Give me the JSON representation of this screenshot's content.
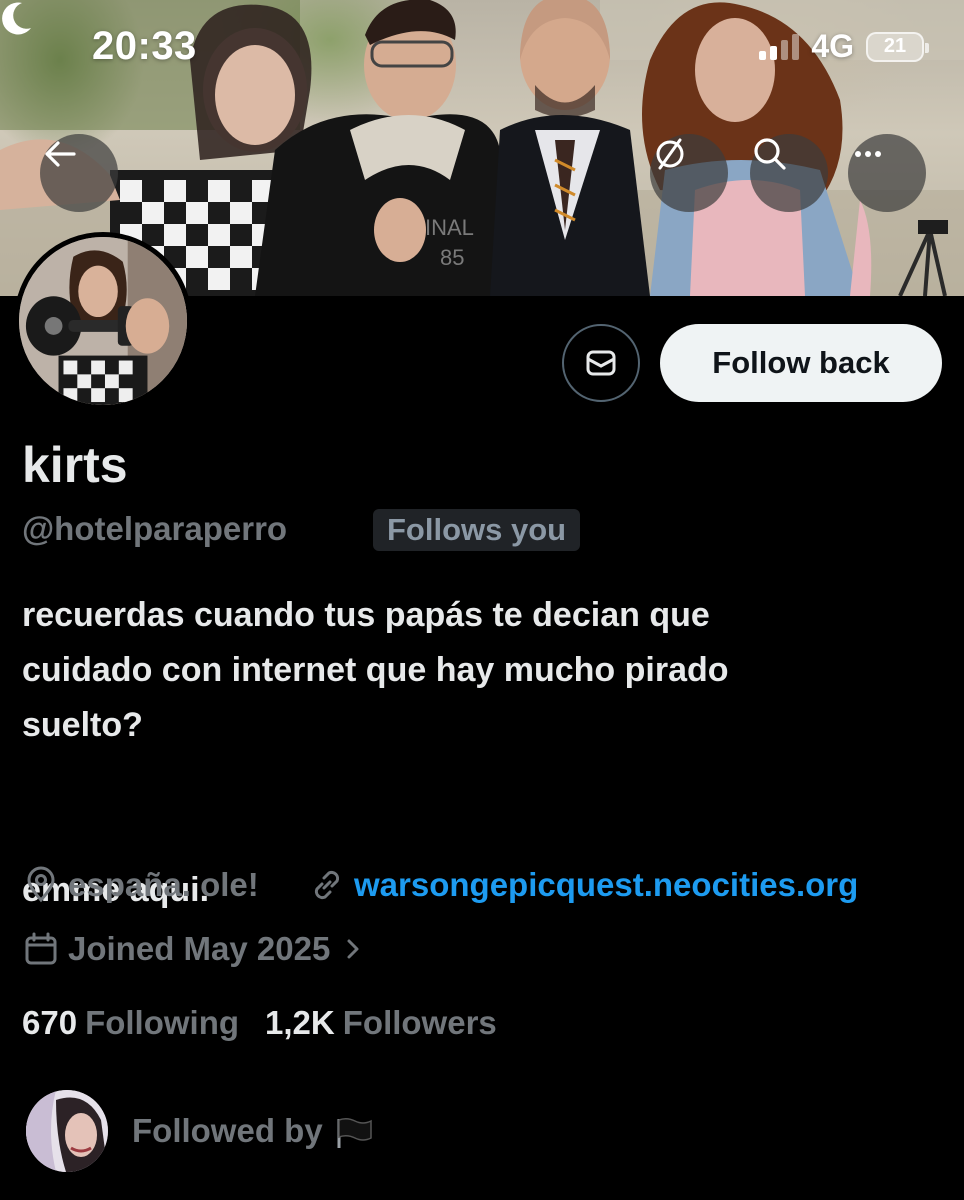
{
  "status_bar": {
    "time": "20:33",
    "network": "4G",
    "battery": "21"
  },
  "header": {
    "icons": [
      "back-arrow-icon",
      "grok-icon",
      "search-icon",
      "more-icon"
    ]
  },
  "actions": {
    "message_icon": "envelope-icon",
    "follow_label": "Follow back"
  },
  "profile": {
    "name": "kirts",
    "handle": "@hotelparaperro",
    "follows_you": "Follows you",
    "bio": "recuerdas cuando tus papás te decian que\ncuidado con internet que hay mucho pirado\nsuelto?\n\n\nemme aqui.",
    "location": "españa. ole!",
    "website": "warsongepicquest.neocities.org",
    "joined": "Joined May 2025"
  },
  "stats": {
    "following_count": "670",
    "following_label": "Following",
    "followers_count": "1,2K",
    "followers_label": "Followers"
  },
  "followed_by": {
    "label": "Followed by",
    "flag_icon": "black-flag-icon"
  },
  "colors": {
    "background": "#000000",
    "text": "#e7e9ea",
    "muted": "#71767b",
    "link": "#1d9bf0",
    "button_bg": "#eff3f4"
  }
}
